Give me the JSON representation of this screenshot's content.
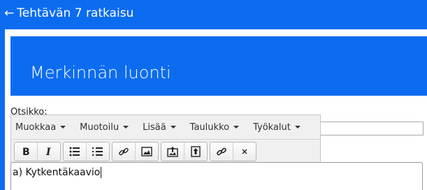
{
  "nav": {
    "back_arrow": "←",
    "back_label": "Tehtävän 7 ratkaisu"
  },
  "header": {
    "title": "Merkinnän luonti"
  },
  "form": {
    "title_label": "Otsikko:",
    "title_value": ""
  },
  "editor": {
    "menus": [
      {
        "label": "Muokkaa"
      },
      {
        "label": "Muotoilu"
      },
      {
        "label": "Lisää"
      },
      {
        "label": "Taulukko"
      },
      {
        "label": "Työkalut"
      }
    ],
    "toolbar_icons": [
      "bold-icon",
      "italic-icon",
      "bullet-list-icon",
      "numbered-list-icon",
      "link-icon",
      "image-icon",
      "upload-image-icon",
      "upload-file-icon",
      "unlink-icon",
      "clear-format-icon"
    ],
    "content": "a) Kytkentäkaavio"
  },
  "colors": {
    "brand": "#0c6cf0"
  }
}
